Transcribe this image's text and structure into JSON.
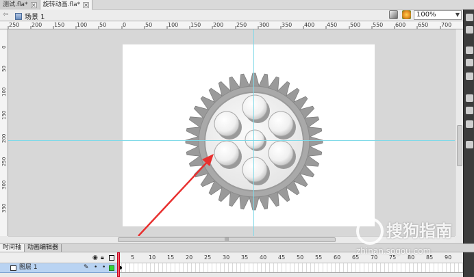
{
  "doc_tabs": [
    {
      "label": "测试.fla*",
      "active": false
    },
    {
      "label": "旋转动画.fla*",
      "active": true
    }
  ],
  "edit_bar": {
    "back_arrow": "⇦",
    "scene_label": "场景 1",
    "zoom_value": "100%"
  },
  "ruler": {
    "h_labels": [
      "250",
      "200",
      "150",
      "100",
      "50",
      "0",
      "50",
      "100",
      "150",
      "200",
      "250",
      "300",
      "350",
      "400",
      "450",
      "500",
      "550",
      "600",
      "650",
      "700"
    ],
    "v_labels": [
      "0",
      "50",
      "100",
      "150",
      "200",
      "250",
      "300",
      "350"
    ]
  },
  "scroll": {
    "h_thumb_grip": "III"
  },
  "timeline": {
    "tabs": [
      {
        "label": "时间轴",
        "active": true
      },
      {
        "label": "动画编辑器",
        "active": false
      }
    ],
    "frame_numbers": [
      "5",
      "10",
      "15",
      "20",
      "25",
      "30",
      "35",
      "40",
      "45",
      "50",
      "55",
      "60",
      "65",
      "70",
      "75",
      "80",
      "85",
      "90"
    ],
    "layer_name": "图层 1"
  },
  "watermark": {
    "brand": "搜狗指南",
    "url": "zhinan.sogou.com"
  },
  "colors": {
    "stage": "#ffffff",
    "workspace": "#d7d7d7",
    "guide": "#7fd9e8",
    "arrow": "#e8302f",
    "gear": "#9a9a9a"
  }
}
